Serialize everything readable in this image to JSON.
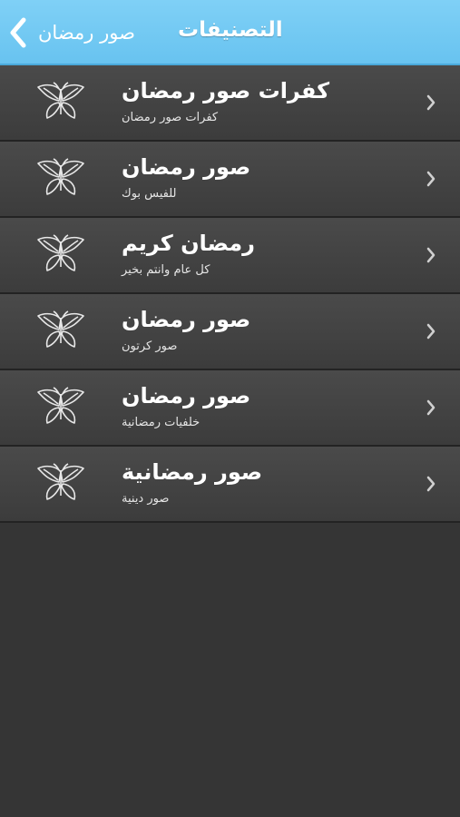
{
  "navbar": {
    "back_label": "صور رمضان",
    "title": "التصنيفات",
    "back_icon": "chevron-left-icon",
    "color": "#72c8f3"
  },
  "list": {
    "items": [
      {
        "title": "كفرات صور رمضان",
        "subtitle": "كفرات صور رمضان",
        "icon": "butterfly-icon"
      },
      {
        "title": "صور رمضان",
        "subtitle": "للفيس بوك",
        "icon": "butterfly-icon"
      },
      {
        "title": "رمضان كريم",
        "subtitle": "كل عام وانتم بخير",
        "icon": "butterfly-icon"
      },
      {
        "title": "صور رمضان",
        "subtitle": "صور كرتون",
        "icon": "butterfly-icon"
      },
      {
        "title": "صور رمضان",
        "subtitle": "خلفيات رمضانية",
        "icon": "butterfly-icon"
      },
      {
        "title": "صور رمضانية",
        "subtitle": "صور دينية",
        "icon": "butterfly-icon"
      }
    ]
  }
}
